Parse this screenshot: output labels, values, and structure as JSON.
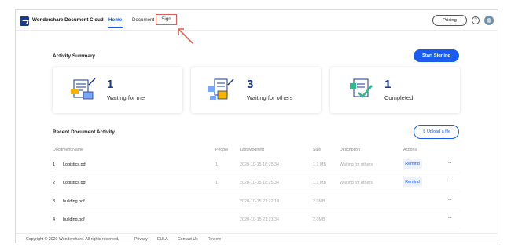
{
  "nav": {
    "brand": "Wondershare Document Cloud",
    "home": "Home",
    "document": "Document",
    "sign": "Sign",
    "pricing": "Pricing",
    "help": "?"
  },
  "activity": {
    "title": "Activity Summary",
    "start_button": "Start Signing",
    "cards": [
      {
        "count": "1",
        "label": "Waiting for me"
      },
      {
        "count": "3",
        "label": "Waiting for others"
      },
      {
        "count": "1",
        "label": "Completed"
      }
    ]
  },
  "recent": {
    "title": "Recent Document Activity",
    "upload_button": "Upload a file",
    "columns": [
      "Document Name",
      "People",
      "Last Modified",
      "Size",
      "Description",
      "Actions"
    ],
    "rows": [
      {
        "index": "1",
        "name": "Logistics.pdf",
        "people": "1",
        "modified": "2020-10-15 18:25:34",
        "size": "1.1 MB",
        "description": "Waiting for others",
        "action": "Remind",
        "more": "···"
      },
      {
        "index": "2",
        "name": "Logistics.pdf",
        "people": "1",
        "modified": "2020-10-15 18:25:34",
        "size": "1.1 MB",
        "description": "Waiting for others",
        "action": "Remind",
        "more": "···"
      },
      {
        "index": "3",
        "name": "building.pdf",
        "people": "",
        "modified": "2020-10-15 21:22:10",
        "size": "2.0MB",
        "description": "",
        "action": "",
        "more": "···"
      },
      {
        "index": "4",
        "name": "building.pdf",
        "people": "",
        "modified": "2020-10-15 21:21:34",
        "size": "2.0MB",
        "description": "",
        "action": "",
        "more": "···"
      }
    ]
  },
  "footer": {
    "copyright": "Copyright © 2020 Wondershare. All rights reserved.",
    "links": [
      "Privacy",
      "EULA",
      "Contact Us",
      "Review"
    ]
  },
  "colors": {
    "accent": "#1b5cf0",
    "brand_dark": "#1a3a8f",
    "highlight": "#e06060"
  }
}
